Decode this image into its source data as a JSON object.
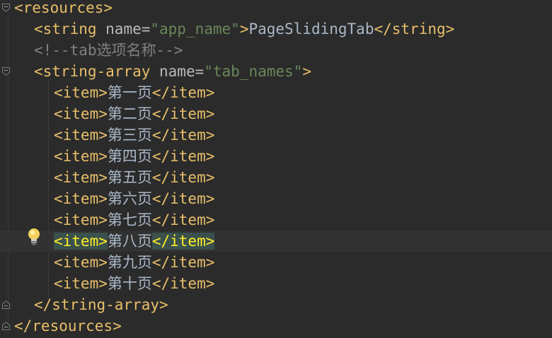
{
  "lines": [
    {
      "indent": 0,
      "parts": [
        {
          "t": "tag",
          "v": "<resources>"
        }
      ]
    },
    {
      "indent": 2,
      "parts": [
        {
          "t": "tag",
          "v": "<string "
        },
        {
          "t": "attr",
          "v": "name="
        },
        {
          "t": "val",
          "v": "\"app_name\""
        },
        {
          "t": "tag",
          "v": ">"
        },
        {
          "t": "txt",
          "v": "PageSlidingTab"
        },
        {
          "t": "tag",
          "v": "</string>"
        }
      ]
    },
    {
      "indent": 2,
      "parts": [
        {
          "t": "cmt",
          "v": "<!--tab选项名称-->"
        }
      ]
    },
    {
      "indent": 2,
      "parts": [
        {
          "t": "tag",
          "v": "<string-array "
        },
        {
          "t": "attr",
          "v": "name="
        },
        {
          "t": "val",
          "v": "\"tab_names\""
        },
        {
          "t": "tag",
          "v": ">"
        }
      ]
    },
    {
      "indent": 4,
      "parts": [
        {
          "t": "tag",
          "v": "<item>"
        },
        {
          "t": "txt",
          "v": "第一页"
        },
        {
          "t": "tag",
          "v": "</item>"
        }
      ]
    },
    {
      "indent": 4,
      "parts": [
        {
          "t": "tag",
          "v": "<item>"
        },
        {
          "t": "txt",
          "v": "第二页"
        },
        {
          "t": "tag",
          "v": "</item>"
        }
      ]
    },
    {
      "indent": 4,
      "parts": [
        {
          "t": "tag",
          "v": "<item>"
        },
        {
          "t": "txt",
          "v": "第三页"
        },
        {
          "t": "tag",
          "v": "</item>"
        }
      ]
    },
    {
      "indent": 4,
      "parts": [
        {
          "t": "tag",
          "v": "<item>"
        },
        {
          "t": "txt",
          "v": "第四页"
        },
        {
          "t": "tag",
          "v": "</item>"
        }
      ]
    },
    {
      "indent": 4,
      "parts": [
        {
          "t": "tag",
          "v": "<item>"
        },
        {
          "t": "txt",
          "v": "第五页"
        },
        {
          "t": "tag",
          "v": "</item>"
        }
      ]
    },
    {
      "indent": 4,
      "parts": [
        {
          "t": "tag",
          "v": "<item>"
        },
        {
          "t": "txt",
          "v": "第六页"
        },
        {
          "t": "tag",
          "v": "</item>"
        }
      ]
    },
    {
      "indent": 4,
      "parts": [
        {
          "t": "tag",
          "v": "<item>"
        },
        {
          "t": "txt",
          "v": "第七页"
        },
        {
          "t": "tag",
          "v": "</item>"
        }
      ]
    },
    {
      "indent": 4,
      "caret": true,
      "parts": [
        {
          "t": "tag match",
          "v": "<item>"
        },
        {
          "t": "txt",
          "v": "第八页"
        },
        {
          "t": "tag match",
          "v": "</item>"
        }
      ]
    },
    {
      "indent": 4,
      "parts": [
        {
          "t": "tag",
          "v": "<item>"
        },
        {
          "t": "txt",
          "v": "第九页"
        },
        {
          "t": "tag",
          "v": "</item>"
        }
      ]
    },
    {
      "indent": 4,
      "parts": [
        {
          "t": "tag",
          "v": "<item>"
        },
        {
          "t": "txt",
          "v": "第十页"
        },
        {
          "t": "tag",
          "v": "</item>"
        }
      ]
    },
    {
      "indent": 2,
      "parts": [
        {
          "t": "tag",
          "v": "</string-array>"
        }
      ]
    },
    {
      "indent": 0,
      "parts": [
        {
          "t": "tag",
          "v": "</resources>"
        }
      ]
    }
  ],
  "gutter": {
    "fold_open_lines": [
      0,
      3
    ],
    "fold_close_lines": [
      14,
      15
    ],
    "intention_icon": "lightbulb-icon"
  },
  "colors": {
    "background": "#2b2b2b",
    "caret_row": "#323232",
    "tag": "#e8bf6a",
    "attribute": "#bababa",
    "string_value": "#6a8759",
    "text": "#a9b7c6",
    "comment": "#808080",
    "tag_match_bg": "#3b514d",
    "tag_match_fg": "#ffef28"
  }
}
